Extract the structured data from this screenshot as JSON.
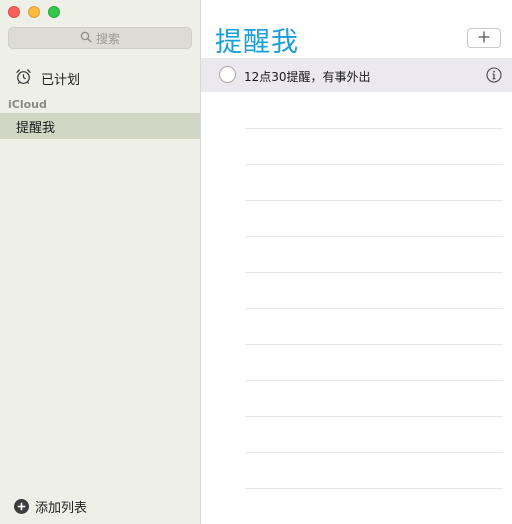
{
  "window": {
    "controls": [
      "close",
      "minimize",
      "zoom"
    ]
  },
  "sidebar": {
    "search_placeholder": "搜索",
    "scheduled_label": "已计划",
    "section_header": "iCloud",
    "lists": [
      {
        "label": "提醒我",
        "selected": true
      }
    ],
    "add_list_label": "添加列表"
  },
  "main": {
    "title": "提醒我",
    "reminders": [
      {
        "text": "12点30提醒，有事外出",
        "completed": false
      }
    ]
  },
  "colors": {
    "accent": "#1a9fd8",
    "sidebar_bg": "#eef0e7",
    "selected_list_bg": "#d1d6c5",
    "selected_row_bg": "#ebe8ef"
  },
  "icons": {
    "search": "search-icon",
    "scheduled": "alarm-clock-icon",
    "add_list": "plus-circle-icon",
    "add_reminder": "plus-icon",
    "info": "info-icon"
  }
}
